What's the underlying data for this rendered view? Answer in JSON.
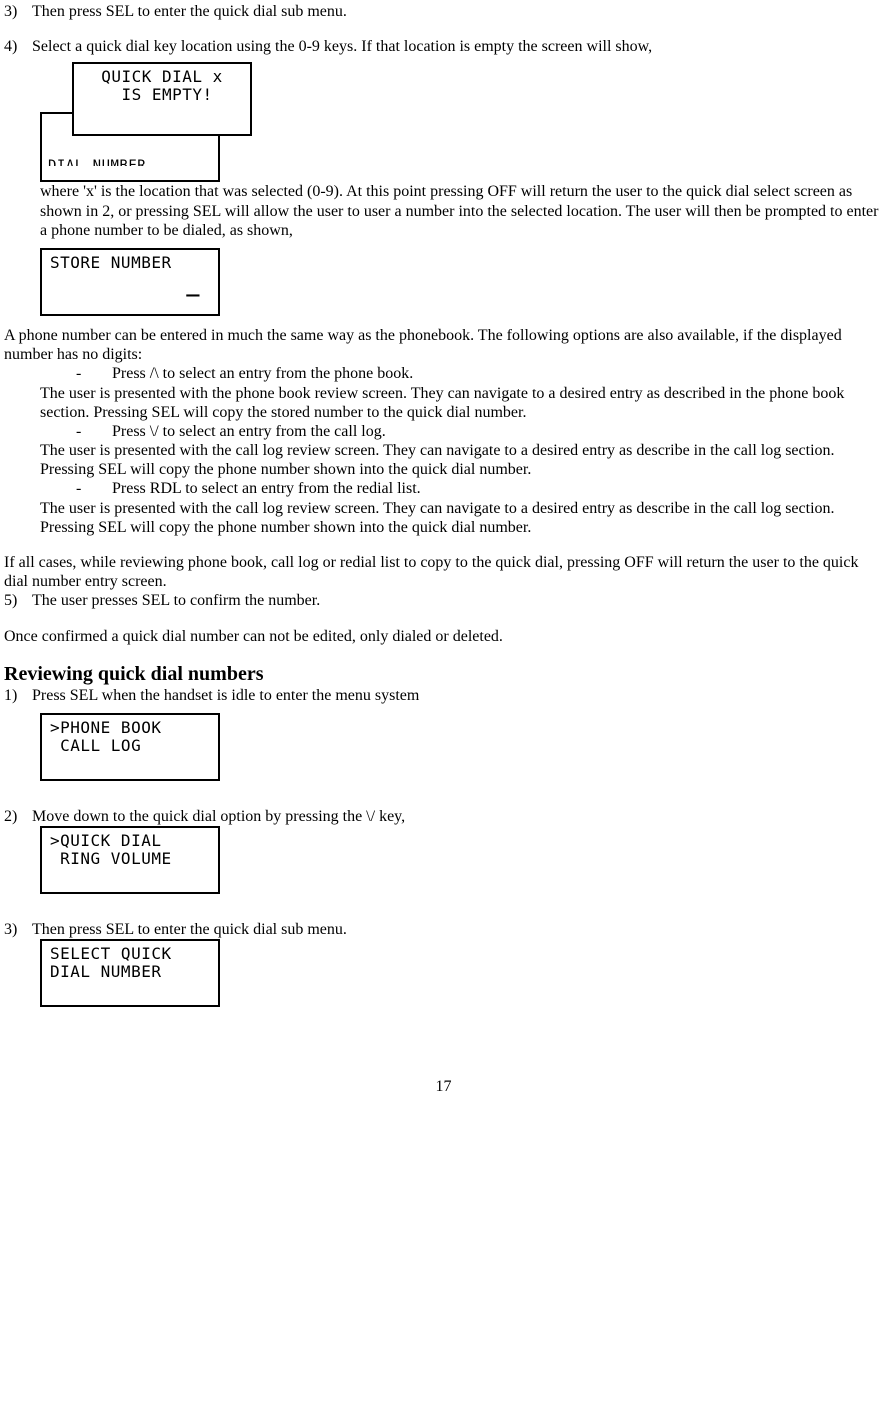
{
  "page_number": "17",
  "steps_a": {
    "s3": {
      "num": "3)",
      "text": "Then press SEL to enter the quick dial sub menu."
    },
    "s4": {
      "num": "4)",
      "text": "Select a quick dial key location using the 0-9 keys.  If that location is empty the screen will show,"
    },
    "s4_after_lcd": "where 'x' is the location that was selected (0-9).   At this point pressing OFF will return the user to the quick dial select screen as shown in 2, or pressing SEL will allow the user to user a number into the selected location. The user will then be prompted to enter a phone number to be dialed, as shown,",
    "s5": {
      "num": "5)",
      "text": "The user presses SEL to confirm the number."
    }
  },
  "lcd1": {
    "front_line1": "QUICK DIAL x",
    "front_line2": " IS EMPTY!",
    "back_clipped": "DIAL NUMBER"
  },
  "lcd2": {
    "line1": "STORE NUMBER",
    "line2_cursor": "_"
  },
  "after_lcd2_intro": "A phone number can be entered in much the same way as the phonebook. The following options are also available, if the displayed number has no digits:",
  "bullets": {
    "b1": {
      "dash": "-",
      "text": "Press /\\ to select an entry from the phone book."
    },
    "b1_body": "The user is presented with the phone book review screen.  They can navigate to a desired entry as described in the phone book section.  Pressing SEL will copy the stored number to the quick dial number.",
    "b2": {
      "dash": "-",
      "text": "Press \\/ to select an entry from the call log."
    },
    "b2_body": "The user is presented with the call log review screen.  They can navigate to a desired entry as describe in the call log section.  Pressing SEL will copy the phone number shown into the quick dial number.",
    "b3": {
      "dash": "-",
      "text": "Press RDL to select an entry from the redial list."
    },
    "b3_body": "The user is presented with the call log review screen.  They can navigate to a desired entry as describe in the call log section.  Pressing SEL will copy the phone number shown into the quick dial number."
  },
  "note_off": "If all cases, while reviewing phone book, call log or redial list to copy to the quick dial, pressing OFF will return the user to the quick dial number entry screen.",
  "note_confirmed": "Once confirmed a quick dial number can not be edited, only dialed or deleted.",
  "section_heading": "Reviewing quick dial numbers",
  "steps_b": {
    "s1": {
      "num": "1)",
      "text": "Press SEL when the handset is idle to enter the menu system"
    },
    "s2": {
      "num": "2)",
      "text": "Move down to the quick dial option by pressing the \\/ key,"
    },
    "s3": {
      "num": "3)",
      "text": "Then press SEL to enter the quick dial sub menu."
    }
  },
  "lcd3": {
    "line1": ">PHONE BOOK",
    "line2": " CALL LOG"
  },
  "lcd4": {
    "line1": ">QUICK DIAL",
    "line2": " RING VOLUME"
  },
  "lcd5": {
    "line1": "SELECT QUICK",
    "line2": "DIAL NUMBER"
  }
}
